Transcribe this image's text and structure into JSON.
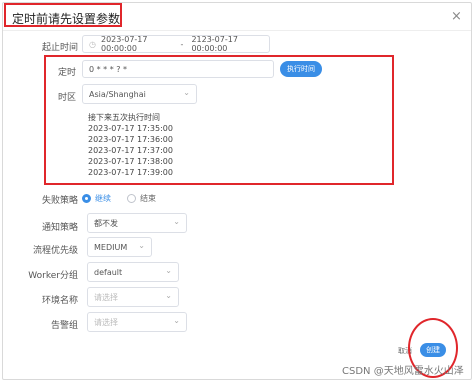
{
  "dialog": {
    "title": "定时前请先设置参数"
  },
  "icons": {
    "close": "×",
    "clock": "◷",
    "chevron": "⌄"
  },
  "form": {
    "start_end": {
      "label": "起止时间",
      "start": "2023-07-17 00:00:00",
      "separator": "-",
      "end": "2123-07-17 00:00:00"
    },
    "cron": {
      "label": "定时",
      "value": "0 * * * ? *",
      "button": "执行时间"
    },
    "timezone": {
      "label": "时区",
      "value": "Asia/Shanghai"
    },
    "preview": {
      "title": "接下来五次执行时间",
      "times": [
        "2023-07-17 17:35:00",
        "2023-07-17 17:36:00",
        "2023-07-17 17:37:00",
        "2023-07-17 17:38:00",
        "2023-07-17 17:39:00"
      ]
    },
    "failure_strategy": {
      "label": "失败策略",
      "options": [
        "继续",
        "结束"
      ],
      "selected": "继续"
    },
    "notify_strategy": {
      "label": "通知策略",
      "value": "都不发"
    },
    "priority": {
      "label": "流程优先级",
      "value": "MEDIUM"
    },
    "worker_group": {
      "label": "Worker分组",
      "value": "default"
    },
    "environment": {
      "label": "环境名称",
      "placeholder": "请选择"
    },
    "alert_group": {
      "label": "告警组",
      "placeholder": "请选择"
    }
  },
  "footer": {
    "cancel": "取消",
    "create": "创建"
  },
  "watermark": "CSDN @天地风雷水火山泽",
  "colors": {
    "primary": "#3a8ee6",
    "highlight": "#e0262b"
  }
}
